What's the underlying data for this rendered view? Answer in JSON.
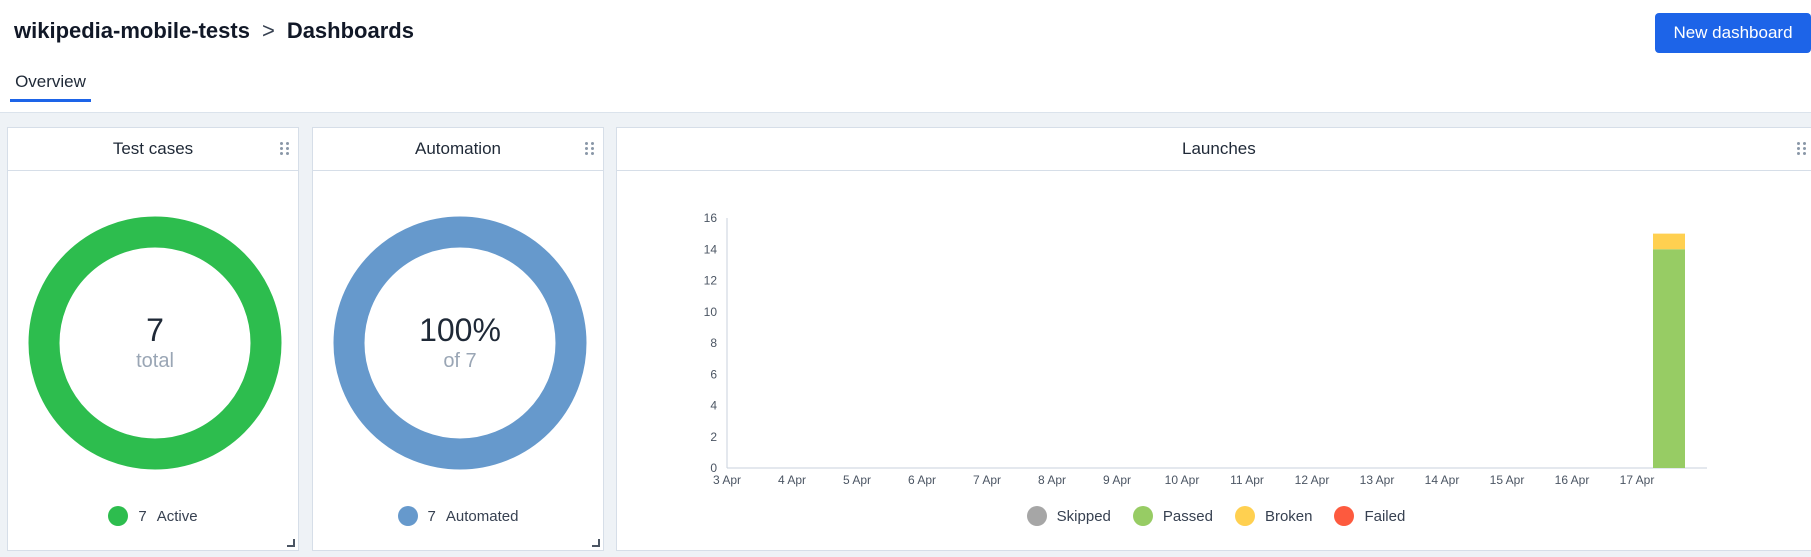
{
  "header": {
    "project": "wikipedia-mobile-tests",
    "separator": ">",
    "page": "Dashboards",
    "new_button": "New dashboard",
    "tab_overview": "Overview"
  },
  "colors": {
    "accent": "#1d64e8",
    "active": "#2dbd4e",
    "automated": "#6699cc",
    "skipped": "#a6a6a6",
    "passed": "#97cc64",
    "broken": "#ffd050",
    "failed": "#fd5a3e"
  },
  "widgets": {
    "test_cases": {
      "title": "Test cases",
      "value": "7",
      "caption": "total",
      "legend_count": "7",
      "legend_label": "Active"
    },
    "automation": {
      "title": "Automation",
      "value": "100%",
      "caption": "of 7",
      "legend_count": "7",
      "legend_label": "Automated",
      "fraction": 1.0
    },
    "launches": {
      "title": "Launches",
      "legend": [
        "Skipped",
        "Passed",
        "Broken",
        "Failed"
      ]
    }
  },
  "chart_data": {
    "type": "bar",
    "stacked": true,
    "title": "Launches",
    "categories": [
      "3 Apr",
      "4 Apr",
      "5 Apr",
      "6 Apr",
      "7 Apr",
      "8 Apr",
      "9 Apr",
      "10 Apr",
      "11 Apr",
      "12 Apr",
      "13 Apr",
      "14 Apr",
      "15 Apr",
      "16 Apr",
      "17 Apr"
    ],
    "series": [
      {
        "name": "Skipped",
        "values": [
          0,
          0,
          0,
          0,
          0,
          0,
          0,
          0,
          0,
          0,
          0,
          0,
          0,
          0,
          0
        ]
      },
      {
        "name": "Passed",
        "values": [
          0,
          0,
          0,
          0,
          0,
          0,
          0,
          0,
          0,
          0,
          0,
          0,
          0,
          0,
          14
        ]
      },
      {
        "name": "Broken",
        "values": [
          0,
          0,
          0,
          0,
          0,
          0,
          0,
          0,
          0,
          0,
          0,
          0,
          0,
          0,
          1
        ]
      },
      {
        "name": "Failed",
        "values": [
          0,
          0,
          0,
          0,
          0,
          0,
          0,
          0,
          0,
          0,
          0,
          0,
          0,
          0,
          0
        ]
      }
    ],
    "yticks": [
      "0",
      "2",
      "4",
      "6",
      "8",
      "10",
      "12",
      "14",
      "16"
    ],
    "ylim": [
      0,
      16
    ],
    "legend": "bottom"
  }
}
